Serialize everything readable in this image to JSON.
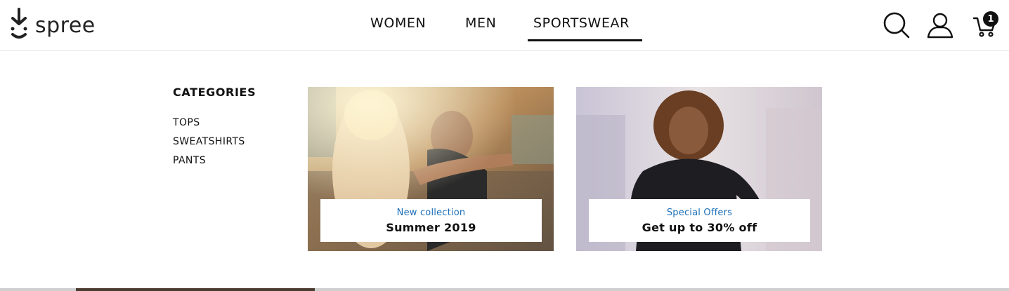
{
  "brand": {
    "name": "spree"
  },
  "nav": {
    "items": [
      {
        "label": "WOMEN"
      },
      {
        "label": "MEN"
      },
      {
        "label": "SPORTSWEAR"
      }
    ],
    "active": "SPORTSWEAR"
  },
  "header_icons": {
    "search": "search-icon",
    "account": "user-icon",
    "cart": "cart-icon",
    "cart_count": "1"
  },
  "menu": {
    "categories_title": "CATEGORIES",
    "categories": [
      "TOPS",
      "SWEATSHIRTS",
      "PANTS"
    ],
    "promos": [
      {
        "kicker": "New collection",
        "headline": "Summer 2019"
      },
      {
        "kicker": "Special Offers",
        "headline": "Get up to 30% off"
      }
    ]
  },
  "colors": {
    "accent_link": "#1c6fb8",
    "text": "#111111",
    "border": "#e3e3e3"
  }
}
